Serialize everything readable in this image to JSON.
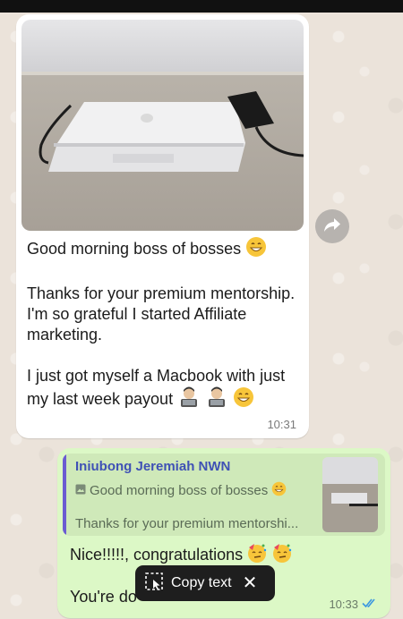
{
  "incoming": {
    "greeting": "Good morning boss of bosses",
    "para2": "Thanks for your premium mentorship. I'm so grateful I started Affiliate marketing.",
    "para3": "I just got myself a Macbook with just my last week payout",
    "time": "10:31"
  },
  "outgoing": {
    "quote_author": "Iniubong Jeremiah NWN",
    "quote_line1": "Good morning boss of bosses",
    "quote_line2": "Thanks for your premium mentorshi...",
    "line1": "Nice!!!!!, congratulations",
    "line2": "You're do",
    "time": "10:33"
  },
  "popup": {
    "copy_label": "Copy text"
  },
  "icons": {
    "forward": "share-forward-icon",
    "read_receipt": "double-check-icon",
    "copy": "text-select-icon",
    "close": "close-icon"
  },
  "colors": {
    "incoming_bg": "#ffffff",
    "outgoing_bg": "#dcf8c6",
    "author": "#3f51b5",
    "read_tick": "#3b97e0"
  }
}
